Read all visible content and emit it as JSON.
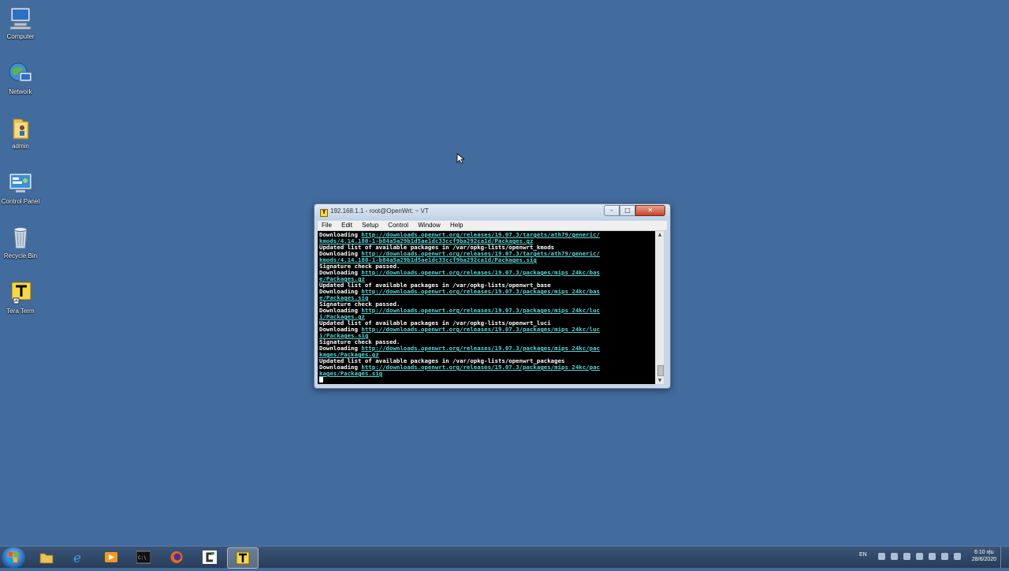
{
  "desktop": {
    "icons": [
      {
        "label": "Computer",
        "icon": "computer-icon"
      },
      {
        "label": "Network",
        "icon": "network-icon"
      },
      {
        "label": "admin",
        "icon": "user-folder-icon"
      },
      {
        "label": "Control Panel",
        "icon": "control-panel-icon"
      },
      {
        "label": "Recycle Bin",
        "icon": "recycle-bin-icon"
      },
      {
        "label": "Tera Term",
        "icon": "tera-term-icon"
      }
    ]
  },
  "window": {
    "title": "192.168.1.1 - root@OpenWrt: ~ VT",
    "app_icon_text": "T",
    "buttons": {
      "minimize": "–",
      "maximize": "□",
      "close": "✕"
    },
    "menu": [
      "File",
      "Edit",
      "Setup",
      "Control",
      "Window",
      "Help"
    ]
  },
  "terminal": {
    "lines": [
      {
        "text": "Downloading ",
        "url": "http://downloads.openwrt.org/releases/19.07.3/targets/ath79/generic/"
      },
      {
        "text": "",
        "url": "kmods/4.14.180-1-b84a5a29b1d5ae1dc33ccf9ba292ca1d/Packages.gz"
      },
      {
        "text": "Updated list of available packages in /var/opkg-lists/openwrt_kmods",
        "url": ""
      },
      {
        "text": "Downloading ",
        "url": "http://downloads.openwrt.org/releases/19.07.3/targets/ath79/generic/"
      },
      {
        "text": "",
        "url": "kmods/4.14.180-1-b84a5a29b1d5ae1dc33ccf9ba292ca1d/Packages.sig"
      },
      {
        "text": "Signature check passed.",
        "url": ""
      },
      {
        "text": "Downloading ",
        "url": "http://downloads.openwrt.org/releases/19.07.3/packages/mips_24kc/bas"
      },
      {
        "text": "",
        "url": "e/Packages.gz"
      },
      {
        "text": "Updated list of available packages in /var/opkg-lists/openwrt_base",
        "url": ""
      },
      {
        "text": "Downloading ",
        "url": "http://downloads.openwrt.org/releases/19.07.3/packages/mips_24kc/bas"
      },
      {
        "text": "",
        "url": "e/Packages.sig"
      },
      {
        "text": "Signature check passed.",
        "url": ""
      },
      {
        "text": "Downloading ",
        "url": "http://downloads.openwrt.org/releases/19.07.3/packages/mips_24kc/luc"
      },
      {
        "text": "",
        "url": "i/Packages.gz"
      },
      {
        "text": "Updated list of available packages in /var/opkg-lists/openwrt_luci",
        "url": ""
      },
      {
        "text": "Downloading ",
        "url": "http://downloads.openwrt.org/releases/19.07.3/packages/mips_24kc/luc"
      },
      {
        "text": "",
        "url": "i/Packages.sig"
      },
      {
        "text": "Signature check passed.",
        "url": ""
      },
      {
        "text": "Downloading ",
        "url": "http://downloads.openwrt.org/releases/19.07.3/packages/mips_24kc/pac"
      },
      {
        "text": "",
        "url": "kages/Packages.gz"
      },
      {
        "text": "Updated list of available packages in /var/opkg-lists/openwrt_packages",
        "url": ""
      },
      {
        "text": "Downloading ",
        "url": "http://downloads.openwrt.org/releases/19.07.3/packages/mips_24kc/pac"
      },
      {
        "text": "",
        "url": "kages/Packages.sig"
      }
    ]
  },
  "taskbar": {
    "items": [
      {
        "name": "file-explorer",
        "active": false
      },
      {
        "name": "internet-explorer",
        "active": false
      },
      {
        "name": "media-player",
        "active": false
      },
      {
        "name": "command-prompt",
        "active": false
      },
      {
        "name": "firefox",
        "active": false
      },
      {
        "name": "cygwin-terminal",
        "active": false
      },
      {
        "name": "tera-term",
        "active": true
      }
    ],
    "tray": {
      "language": "EN",
      "time": "6:10 ทุ่ม",
      "date": "28/6/2020"
    }
  },
  "colors": {
    "desktop_bg": "#426b9e",
    "terminal_bg": "#000000",
    "terminal_fg": "#ffffff",
    "url_fg": "#57d3d6"
  }
}
